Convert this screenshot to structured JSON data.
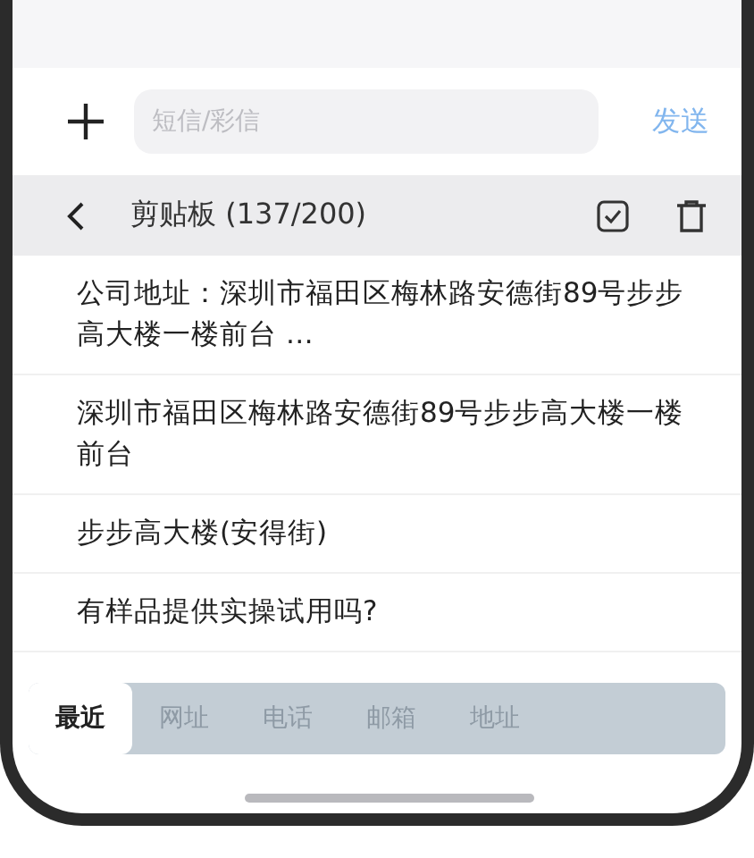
{
  "compose": {
    "placeholder": "短信/彩信",
    "send": "发送"
  },
  "clipboard": {
    "title": "剪贴板 (137/200)",
    "items": [
      {
        "text": "公司地址：深圳市福田区梅林路安德街89号步步高大楼一楼前台 …"
      },
      {
        "text": "深圳市福田区梅林路安德街89号步步高大楼一楼前台"
      },
      {
        "text": "步步高大楼(安得街)"
      },
      {
        "text": "有样品提供实操试用吗?"
      }
    ],
    "tabs": [
      {
        "label": "最近",
        "selected": true
      },
      {
        "label": "网址",
        "selected": false
      },
      {
        "label": "电话",
        "selected": false
      },
      {
        "label": "邮箱",
        "selected": false
      },
      {
        "label": "地址",
        "selected": false
      }
    ]
  }
}
